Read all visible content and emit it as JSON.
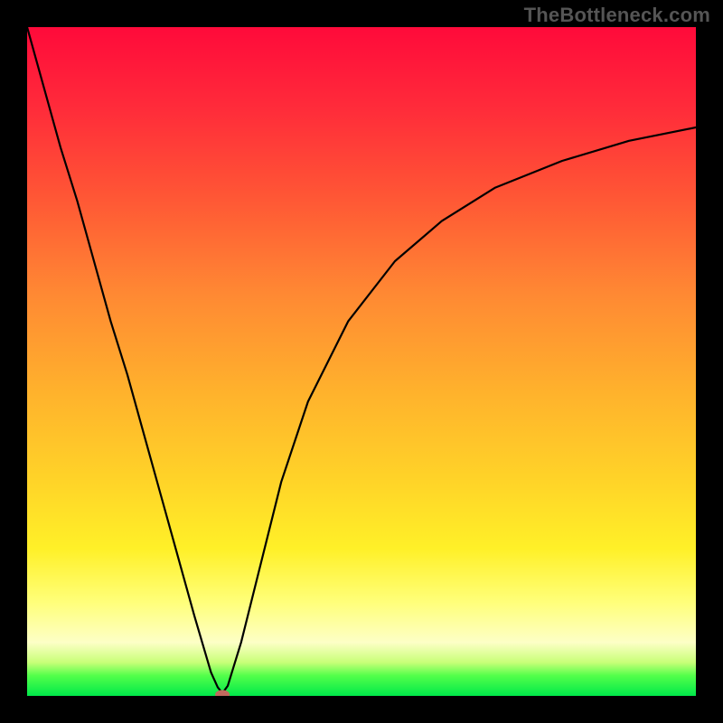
{
  "watermark": "TheBottleneck.com",
  "chart_data": {
    "type": "line",
    "title": "",
    "xlabel": "",
    "ylabel": "",
    "xlim": [
      0,
      100
    ],
    "ylim": [
      0,
      100
    ],
    "grid": false,
    "gradient_stops": [
      {
        "pos": 0.0,
        "color": "#ff0a3a"
      },
      {
        "pos": 0.12,
        "color": "#ff2b3a"
      },
      {
        "pos": 0.25,
        "color": "#ff5535"
      },
      {
        "pos": 0.4,
        "color": "#ff8933"
      },
      {
        "pos": 0.55,
        "color": "#ffb32c"
      },
      {
        "pos": 0.68,
        "color": "#ffd428"
      },
      {
        "pos": 0.78,
        "color": "#fff028"
      },
      {
        "pos": 0.86,
        "color": "#ffff7a"
      },
      {
        "pos": 0.92,
        "color": "#fdffc6"
      },
      {
        "pos": 0.95,
        "color": "#c8ff78"
      },
      {
        "pos": 0.97,
        "color": "#52ff4a"
      },
      {
        "pos": 1.0,
        "color": "#00e84a"
      }
    ],
    "series": [
      {
        "name": "bottleneck-curve",
        "x": [
          0.0,
          2.5,
          5.0,
          7.5,
          10.0,
          12.5,
          15.0,
          17.5,
          20.0,
          22.5,
          25.0,
          27.5,
          28.5,
          29.2,
          30.0,
          32.0,
          35.0,
          38.0,
          42.0,
          48.0,
          55.0,
          62.0,
          70.0,
          80.0,
          90.0,
          100.0
        ],
        "y": [
          100,
          91,
          82,
          74,
          65,
          56,
          48,
          39,
          30,
          21,
          12,
          3.5,
          1.3,
          0.4,
          1.5,
          8,
          20,
          32,
          44,
          56,
          65,
          71,
          76,
          80,
          83,
          85
        ]
      }
    ],
    "minimum_point": {
      "x": 29.2,
      "y": 0.2
    }
  }
}
